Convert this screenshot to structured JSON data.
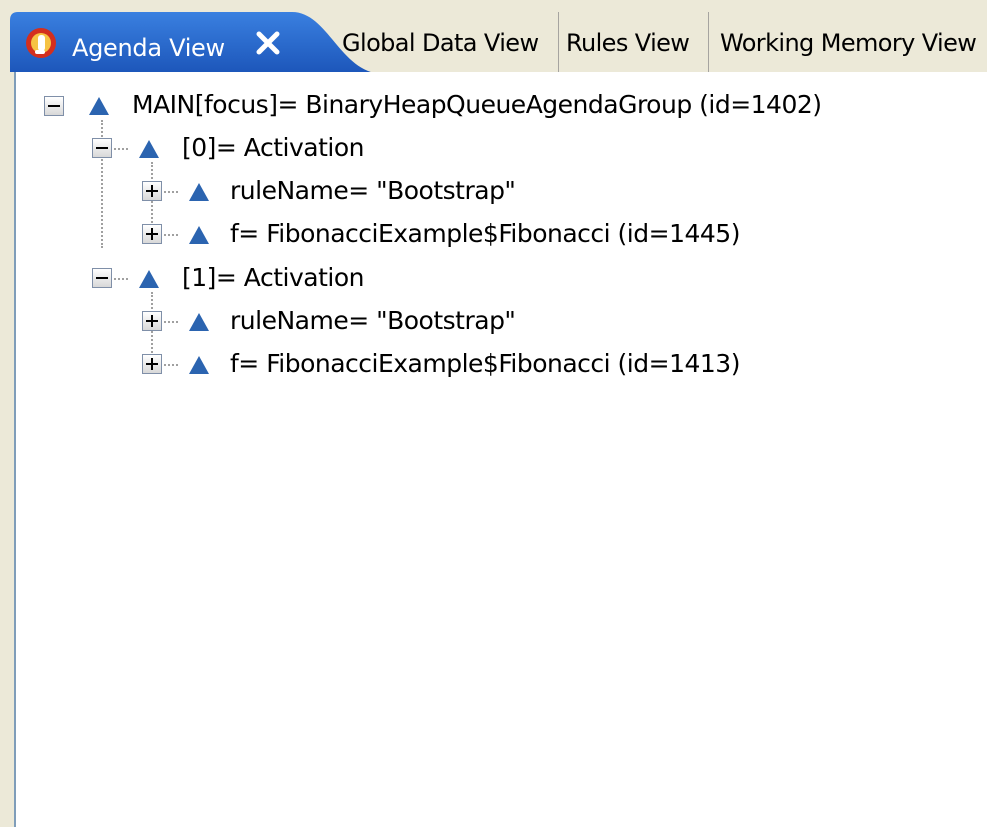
{
  "tabs": {
    "active": {
      "label": "Agenda View",
      "icon": "drools-icon"
    },
    "others": [
      {
        "label": "Global Data View"
      },
      {
        "label": "Rules View"
      },
      {
        "label": "Working Memory View"
      }
    ]
  },
  "tree": {
    "root": {
      "label": "MAIN[focus]= BinaryHeapQueueAgendaGroup  (id=1402)",
      "expanded": true
    },
    "activations": [
      {
        "label": "[0]= Activation",
        "expanded": true,
        "children": [
          {
            "label": "ruleName= \"Bootstrap\"",
            "expanded": false
          },
          {
            "label": "f= FibonacciExample$Fibonacci  (id=1445)",
            "expanded": false
          }
        ]
      },
      {
        "label": "[1]= Activation",
        "expanded": true,
        "children": [
          {
            "label": "ruleName= \"Bootstrap\"",
            "expanded": false
          },
          {
            "label": "f= FibonacciExample$Fibonacci  (id=1413)",
            "expanded": false
          }
        ]
      }
    ]
  },
  "colors": {
    "active_tab": "#1f5fc5",
    "tab_strip": "#ece9d8",
    "node_triangle": "#2b64b0"
  }
}
